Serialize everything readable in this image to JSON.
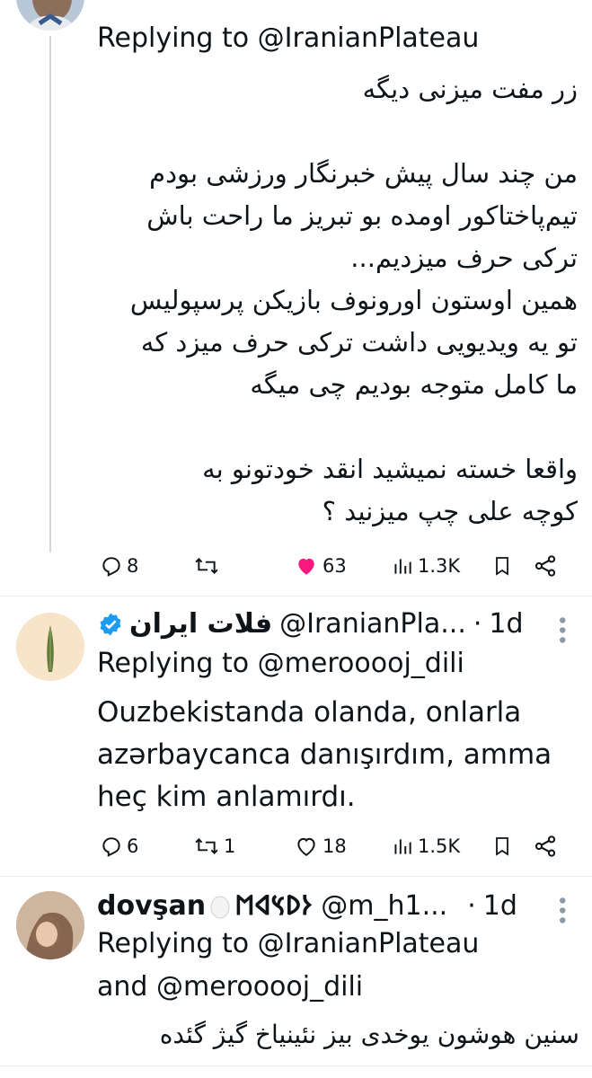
{
  "tweet1": {
    "reply_to_prefix": "Replying to ",
    "reply_to_handle": "@IranianPlateau",
    "body_lines": [
      "زر مفت میزنی دیگه",
      "",
      "من چند سال پیش خبرنگار ورزشی بودم",
      "تیم‌پاختاکور اومده بو تبریز ما راحت باش",
      "ترکی حرف میزدیم...",
      "همین اوستون اورونوف بازیکن پرسپولیس",
      "تو یه ویدیویی داشت ترکی حرف میزد که",
      "ما کامل متوجه بودیم چی میگه",
      "",
      "واقعا خسته نمیشید انقد خودتونو به",
      "کوچه علی چپ میزنید ؟"
    ],
    "actions": {
      "replies": "8",
      "reposts": "",
      "likes": "63",
      "views": "1.3K"
    }
  },
  "tweet2": {
    "name": "فلات ایران",
    "handle": "@IranianPla...",
    "dot": "·",
    "time": "1d",
    "reply_to_prefix": "Replying to ",
    "reply_to_handle": "@merooooj_dili",
    "body_lines": [
      "Ouzbekistanda olanda, onlarla",
      "azərbaycanca danışırdım, amma",
      "heç kim anlamırdı."
    ],
    "actions": {
      "replies": "6",
      "reposts": "1",
      "likes": "18",
      "views": "1.5K"
    }
  },
  "tweet3": {
    "name": "dovşan",
    "name_suffix": "𐰆𐰖𐰽𐰶𐰡",
    "handle": "@m_h1...",
    "dot": "·",
    "time": "1d",
    "reply_to_prefix": "Replying to ",
    "reply_to_handle": "@IranianPlateau",
    "reply_to_and": "and ",
    "reply_to_handle2": "@merooooj_dili",
    "body_lines": [
      "سنین هوشون یوخدی بیز نئینیاخ گیژ گئده"
    ]
  },
  "colors": {
    "like_active": "#f91880",
    "verified": "#1d9bf0",
    "divider": "#e6ecf0",
    "thread_line": "#cfd9de"
  }
}
